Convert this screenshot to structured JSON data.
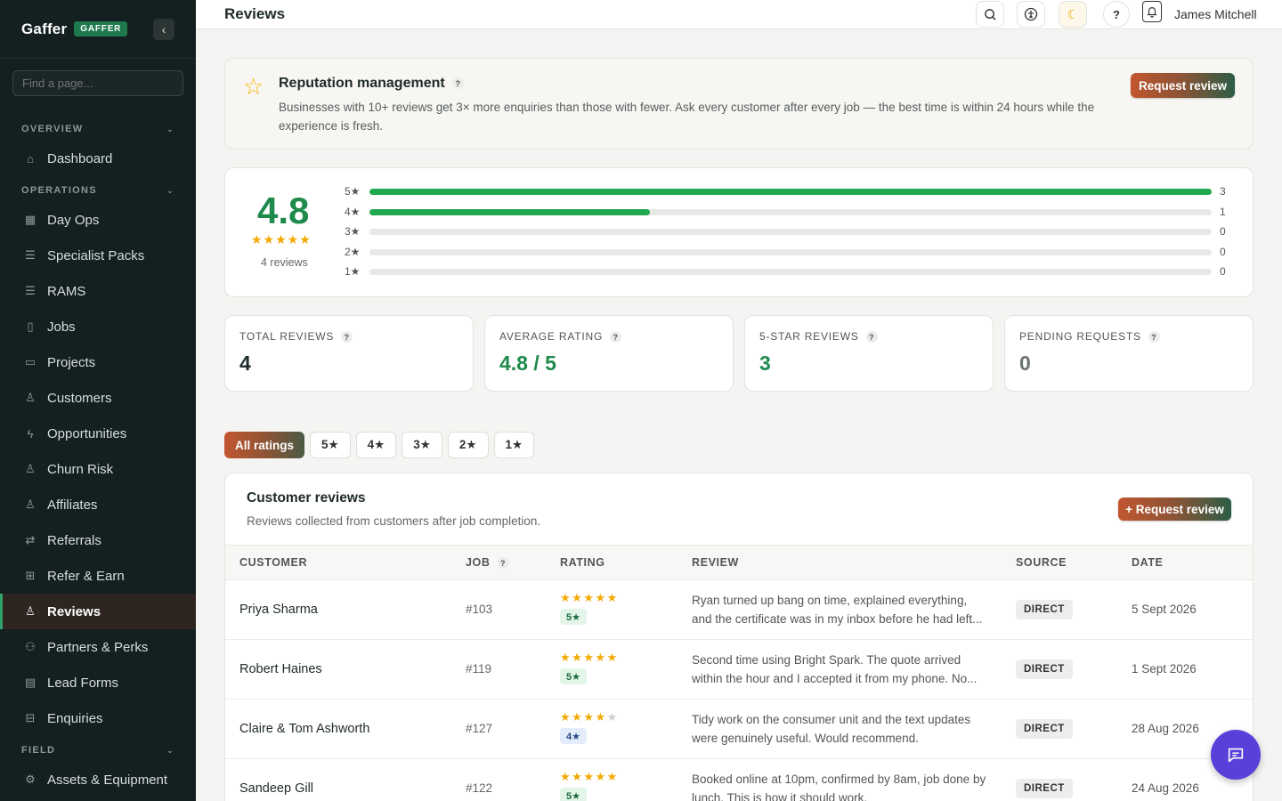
{
  "brand": {
    "name": "Gaffer",
    "badge": "GAFFER"
  },
  "sidebar": {
    "search_placeholder": "Find a page...",
    "sections": [
      {
        "label": "OVERVIEW",
        "items": [
          {
            "label": "Dashboard",
            "icon": "home-icon"
          }
        ]
      },
      {
        "label": "OPERATIONS",
        "items": [
          {
            "label": "Day Ops",
            "icon": "calendar-icon"
          },
          {
            "label": "Specialist Packs",
            "icon": "list-icon"
          },
          {
            "label": "RAMS",
            "icon": "list-icon"
          },
          {
            "label": "Jobs",
            "icon": "clipboard-icon"
          },
          {
            "label": "Projects",
            "icon": "folder-icon"
          },
          {
            "label": "Customers",
            "icon": "user-icon"
          },
          {
            "label": "Opportunities",
            "icon": "lightning-icon"
          },
          {
            "label": "Churn Risk",
            "icon": "user-icon"
          },
          {
            "label": "Affiliates",
            "icon": "user-icon"
          },
          {
            "label": "Referrals",
            "icon": "arrows-icon"
          },
          {
            "label": "Refer & Earn",
            "icon": "gift-icon"
          },
          {
            "label": "Reviews",
            "icon": "user-icon",
            "active": true
          },
          {
            "label": "Partners & Perks",
            "icon": "users-icon"
          },
          {
            "label": "Lead Forms",
            "icon": "document-icon"
          },
          {
            "label": "Enquiries",
            "icon": "inbox-icon"
          }
        ]
      },
      {
        "label": "FIELD",
        "items": [
          {
            "label": "Assets & Equipment",
            "icon": "gear-icon"
          }
        ]
      }
    ]
  },
  "topbar": {
    "title": "Reviews",
    "user": "James Mitchell"
  },
  "reputation": {
    "title": "Reputation management",
    "text": "Businesses with 10+ reviews get 3× more enquiries than those with fewer. Ask every customer after every job — the best time is within 24 hours while the experience is fresh.",
    "button": "Request review"
  },
  "summary": {
    "rating": "4.8",
    "stars": "★★★★★",
    "count_label": "4 reviews",
    "breakdown": [
      {
        "label": "5★",
        "count": 3,
        "fraction": 1.0
      },
      {
        "label": "4★",
        "count": 1,
        "fraction": 0.333
      },
      {
        "label": "3★",
        "count": 0,
        "fraction": 0
      },
      {
        "label": "2★",
        "count": 0,
        "fraction": 0
      },
      {
        "label": "1★",
        "count": 0,
        "fraction": 0
      }
    ]
  },
  "stats": [
    {
      "label": "TOTAL REVIEWS",
      "value": "4",
      "color": "#1f2a2a"
    },
    {
      "label": "AVERAGE RATING",
      "value": "4.8 / 5",
      "color": "#1e8a4c"
    },
    {
      "label": "5-STAR REVIEWS",
      "value": "3",
      "color": "#1e8a4c"
    },
    {
      "label": "PENDING REQUESTS",
      "value": "0",
      "color": "#6b7372"
    }
  ],
  "filters": [
    "All ratings",
    "5★",
    "4★",
    "3★",
    "2★",
    "1★"
  ],
  "reviews": {
    "title": "Customer reviews",
    "subtitle": "Reviews collected from customers after job completion.",
    "button": "+ Request review",
    "columns": [
      "CUSTOMER",
      "JOB",
      "RATING",
      "REVIEW",
      "SOURCE",
      "DATE"
    ],
    "rows": [
      {
        "customer": "Priya Sharma",
        "job": "#103",
        "rating": 5,
        "pill": "5★",
        "review": "Ryan turned up bang on time, explained everything, and the certificate was in my inbox before he had left...",
        "source": "DIRECT",
        "date": "5 Sept 2026"
      },
      {
        "customer": "Robert Haines",
        "job": "#119",
        "rating": 5,
        "pill": "5★",
        "review": "Second time using Bright Spark. The quote arrived within the hour and I accepted it from my phone. No...",
        "source": "DIRECT",
        "date": "1 Sept 2026"
      },
      {
        "customer": "Claire & Tom Ashworth",
        "job": "#127",
        "rating": 4,
        "pill": "4★",
        "review": "Tidy work on the consumer unit and the text updates were genuinely useful. Would recommend.",
        "source": "DIRECT",
        "date": "28 Aug 2026"
      },
      {
        "customer": "Sandeep Gill",
        "job": "#122",
        "rating": 5,
        "pill": "5★",
        "review": "Booked online at 10pm, confirmed by 8am, job done by lunch. This is how it should work.",
        "source": "DIRECT",
        "date": "24 Aug 2026"
      }
    ]
  }
}
